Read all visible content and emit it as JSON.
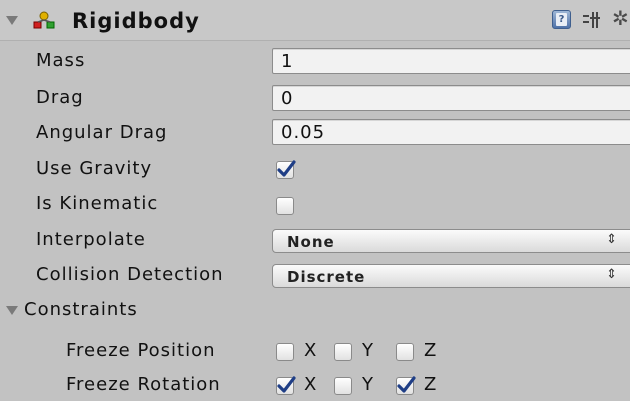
{
  "component": {
    "title": "Rigidbody",
    "help_icon": "help-icon",
    "preset_icon": "preset-icon",
    "settings_icon": "gear-icon"
  },
  "properties": {
    "mass": {
      "label": "Mass",
      "value": "1"
    },
    "drag": {
      "label": "Drag",
      "value": "0"
    },
    "angular_drag": {
      "label": "Angular Drag",
      "value": "0.05"
    },
    "use_gravity": {
      "label": "Use Gravity",
      "checked": true
    },
    "is_kinematic": {
      "label": "Is Kinematic",
      "checked": false
    },
    "interpolate": {
      "label": "Interpolate",
      "value": "None"
    },
    "collision_detection": {
      "label": "Collision Detection",
      "value": "Discrete"
    }
  },
  "constraints": {
    "label": "Constraints",
    "freeze_position": {
      "label": "Freeze Position",
      "axes": [
        {
          "axis": "X",
          "checked": false
        },
        {
          "axis": "Y",
          "checked": false
        },
        {
          "axis": "Z",
          "checked": false
        }
      ]
    },
    "freeze_rotation": {
      "label": "Freeze Rotation",
      "axes": [
        {
          "axis": "X",
          "checked": true
        },
        {
          "axis": "Y",
          "checked": false
        },
        {
          "axis": "Z",
          "checked": true
        }
      ]
    }
  },
  "dropdown_arrow": "⇕"
}
